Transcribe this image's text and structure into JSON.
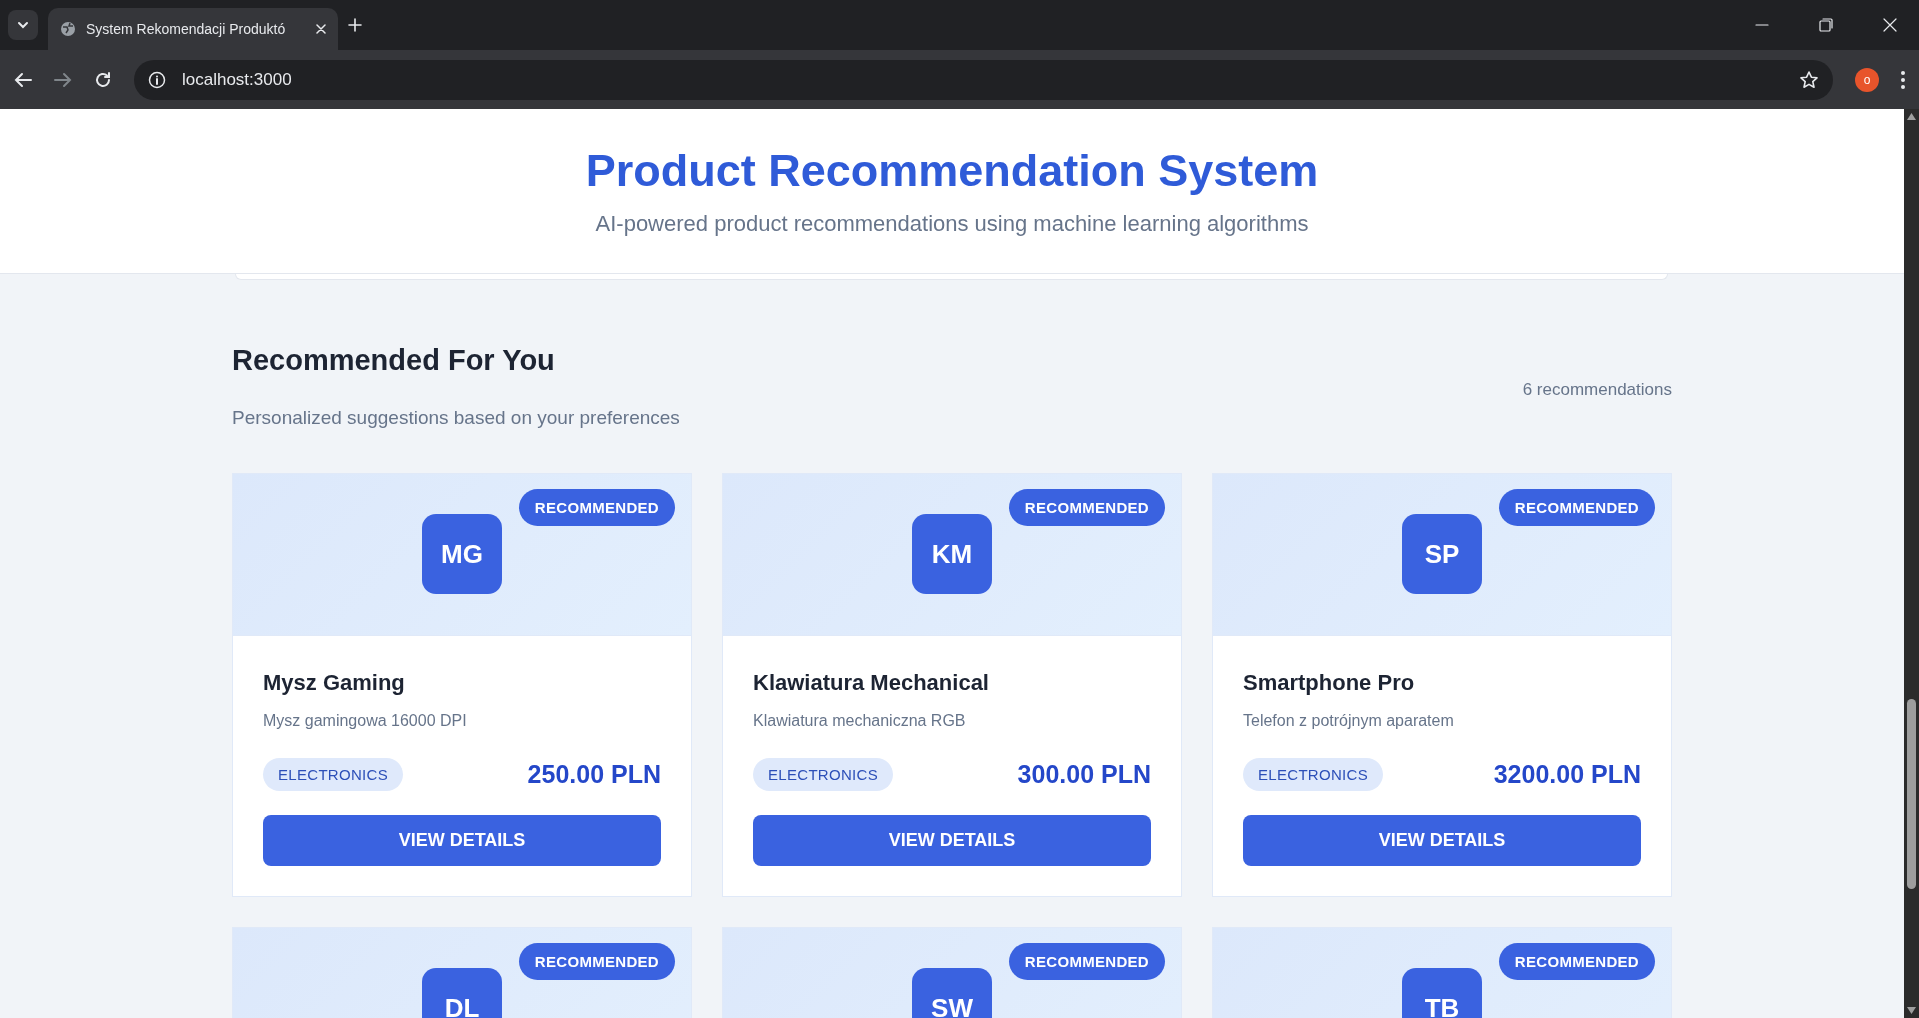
{
  "browser": {
    "tab_title": "System Rekomendacji Produktó",
    "url": "localhost:3000",
    "profile_initial": "o"
  },
  "header": {
    "title": "Product Recommendation System",
    "subtitle": "AI-powered product recommendations using machine learning algorithms"
  },
  "section": {
    "title": "Recommended For You",
    "count": "6 recommendations",
    "subtitle": "Personalized suggestions based on your preferences"
  },
  "products": [
    {
      "initials": "MG",
      "badge": "RECOMMENDED",
      "name": "Mysz Gaming",
      "description": "Mysz gamingowa 16000 DPI",
      "category": "ELECTRONICS",
      "price": "250.00 PLN",
      "button": "VIEW DETAILS"
    },
    {
      "initials": "KM",
      "badge": "RECOMMENDED",
      "name": "Klawiatura Mechanical",
      "description": "Klawiatura mechaniczna RGB",
      "category": "ELECTRONICS",
      "price": "300.00 PLN",
      "button": "VIEW DETAILS"
    },
    {
      "initials": "SP",
      "badge": "RECOMMENDED",
      "name": "Smartphone Pro",
      "description": "Telefon z potrójnym aparatem",
      "category": "ELECTRONICS",
      "price": "3200.00 PLN",
      "button": "VIEW DETAILS"
    },
    {
      "initials": "DL",
      "badge": "RECOMMENDED"
    },
    {
      "initials": "SW",
      "badge": "RECOMMENDED"
    },
    {
      "initials": "TB",
      "badge": "RECOMMENDED"
    }
  ]
}
